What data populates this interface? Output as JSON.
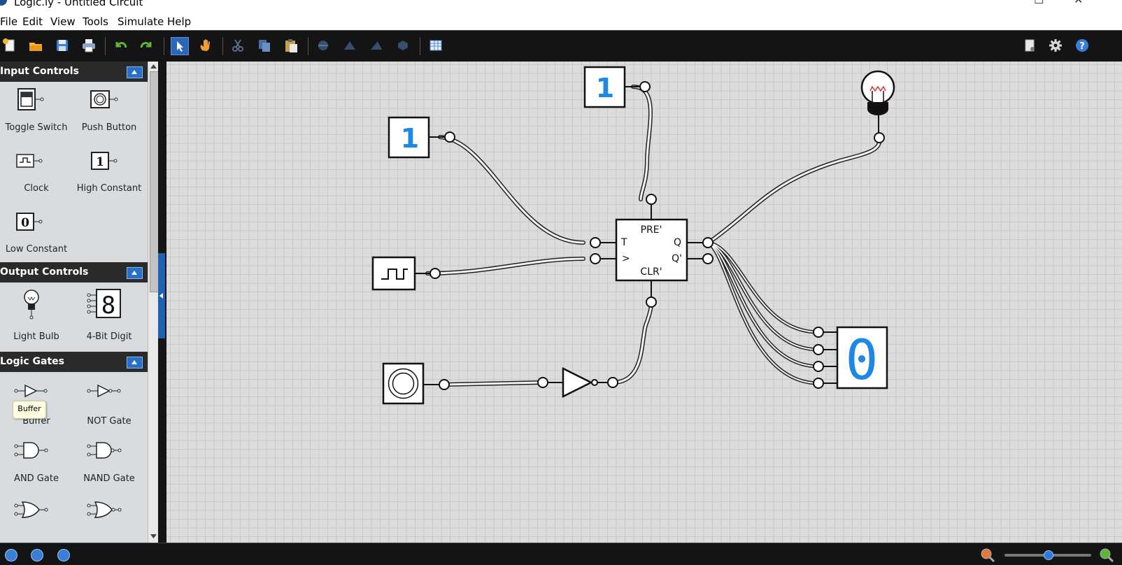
{
  "window": {
    "title": "Logic.ly - Untitled Circuit"
  },
  "menu": {
    "items": [
      "File",
      "Edit",
      "View",
      "Tools",
      "Simulate",
      "Help"
    ]
  },
  "toolbar": {
    "tools": [
      "new-icon",
      "open-icon",
      "save-icon",
      "print-icon",
      "undo-icon",
      "redo-icon",
      "select-tool-icon",
      "pan-tool-icon",
      "cut-icon",
      "copy-icon",
      "paste-icon",
      "rotate-icon",
      "flip-horizontal-icon",
      "flip-vertical-icon",
      "group-icon",
      "truth-table-icon"
    ],
    "right_tools": [
      "document-properties-icon",
      "settings-gear-icon",
      "help-icon"
    ]
  },
  "sidebar": {
    "sections": [
      {
        "title": "Input Controls",
        "items": [
          "Toggle Switch",
          "Push Button",
          "Clock",
          "High Constant",
          "Low Constant"
        ]
      },
      {
        "title": "Output Controls",
        "items": [
          "Light Bulb",
          "4-Bit Digit"
        ]
      },
      {
        "title": "Logic Gates",
        "items": [
          "Buffer",
          "NOT Gate",
          "AND Gate",
          "NAND Gate"
        ]
      }
    ],
    "tooltip": "Buffer"
  },
  "circuit": {
    "flipflop": {
      "pre": "PRE'",
      "clr": "CLR'",
      "t": "T",
      "clk": ">",
      "q": "Q",
      "qbar": "Q'"
    },
    "high_constant_value": "1",
    "digit_value": "0"
  },
  "colors": {
    "accent": "#2670c9",
    "digit": "#1e88e5",
    "canvas": "#dcdcdc",
    "toolbar": "#141414"
  },
  "statusbar": {
    "zoom_level": 0.5
  }
}
